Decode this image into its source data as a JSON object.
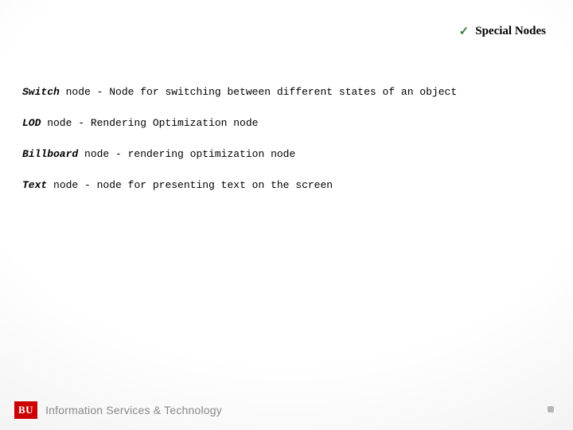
{
  "header": {
    "checkmark": "✓",
    "title": "Special Nodes"
  },
  "lines": [
    {
      "name": "Switch",
      "suffix": " node",
      "gap": "  ",
      "desc": "- Node for switching between different states of an object"
    },
    {
      "name": "LOD",
      "suffix": " node ",
      "gap": "",
      "desc": "- Rendering Optimization node"
    },
    {
      "name": "Billboard",
      "suffix": " node ",
      "gap": "",
      "desc": "- rendering optimization node"
    },
    {
      "name": "Text",
      "suffix": " node ",
      "gap": "",
      "desc": "- node for presenting text on the screen"
    }
  ],
  "footer": {
    "brand_short": "BU",
    "brand_long": "Information Services & Technology"
  }
}
